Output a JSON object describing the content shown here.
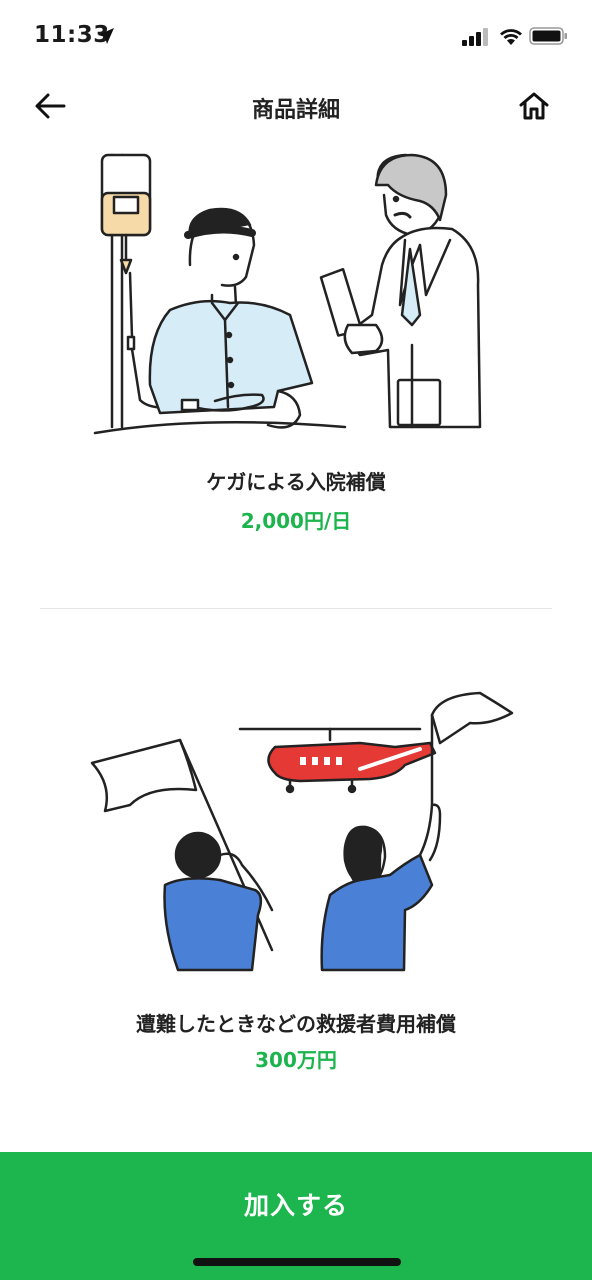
{
  "status_bar": {
    "time": "11:33",
    "icons": [
      "location-arrow-icon",
      "cellular-signal-icon",
      "wifi-icon",
      "battery-icon"
    ]
  },
  "nav": {
    "title": "商品詳細",
    "back_icon": "arrow-left-icon",
    "home_icon": "home-icon"
  },
  "items": [
    {
      "name": "ケガによる入院補償",
      "value": "2,000円/日",
      "illustration": "hospital-patient-doctor-illustration"
    },
    {
      "name": "遭難したときなどの救援者費用補償",
      "value": "300万円",
      "illustration": "rescue-helicopter-flags-illustration"
    }
  ],
  "cta": {
    "label": "加入する"
  },
  "colors": {
    "accent": "#1cb44c",
    "button": "#1db64e",
    "text": "#222222"
  }
}
